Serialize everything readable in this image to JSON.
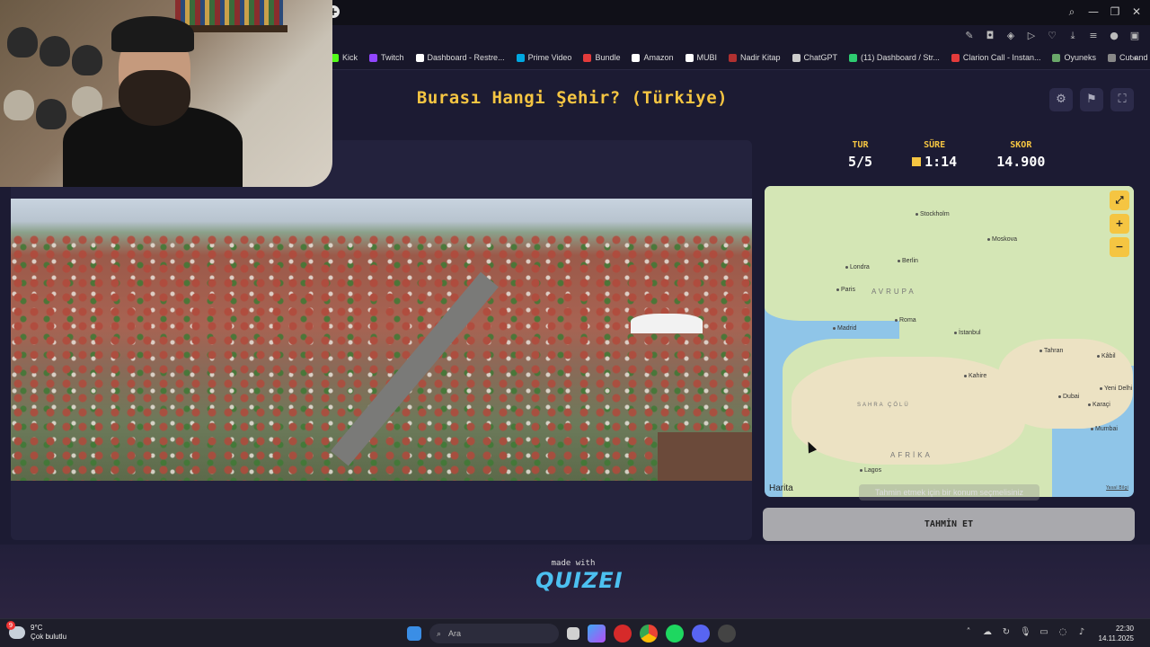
{
  "browser": {
    "bookmarks": [
      {
        "label": "Kick",
        "color": "#53fc18"
      },
      {
        "label": "Twitch",
        "color": "#9146ff"
      },
      {
        "label": "Dashboard - Restre...",
        "color": "#ffffff"
      },
      {
        "label": "Prime Video",
        "color": "#00a8e1"
      },
      {
        "label": "Bundle",
        "color": "#e33b3b"
      },
      {
        "label": "Amazon",
        "color": "#ffffff"
      },
      {
        "label": "MUBI",
        "color": "#ffffff"
      },
      {
        "label": "Nadir Kitap",
        "color": "#b03030"
      },
      {
        "label": "ChatGPT",
        "color": "#cccccc"
      },
      {
        "label": "(11) Dashboard / Str...",
        "color": "#2ecc71"
      },
      {
        "label": "Clarion Call - Instan...",
        "color": "#e33b3b"
      },
      {
        "label": "Oyuneks",
        "color": "#6aa86a"
      },
      {
        "label": "Cut and Download...",
        "color": "#888888"
      }
    ]
  },
  "game": {
    "title": "Burası Hangi Şehir? (Türkiye)",
    "stats": {
      "round_label": "TUR",
      "round_value": "5/5",
      "time_label": "SÜRE",
      "time_value": "1:14",
      "score_label": "SKOR",
      "score_value": "14.900"
    },
    "map": {
      "cities": [
        "Stockholm",
        "Moskova",
        "Londra",
        "Berlin",
        "Paris",
        "Roma",
        "Madrid",
        "İstanbul",
        "Tahran",
        "Kahire",
        "Dubai",
        "Karaçi",
        "Kâbil",
        "Yeni Delhi",
        "Mumbai",
        "Lagos"
      ],
      "regions": [
        "AVRUPA",
        "SAHRA ÇÖLÜ",
        "AFRİKA"
      ],
      "attribution": "Harita",
      "legal": "Yasal Bilgi"
    },
    "hint": "Tahmin etmek için bir konum seçmelisiniz",
    "guess_button": "TAHMİN ET",
    "made_with": "made with",
    "brand": "QUIZEI"
  },
  "taskbar": {
    "weather_temp": "9°C",
    "weather_desc": "Çok bulutlu",
    "weather_badge": "9",
    "search_placeholder": "Ara",
    "time": "22:30",
    "date": "14.11.2025"
  }
}
